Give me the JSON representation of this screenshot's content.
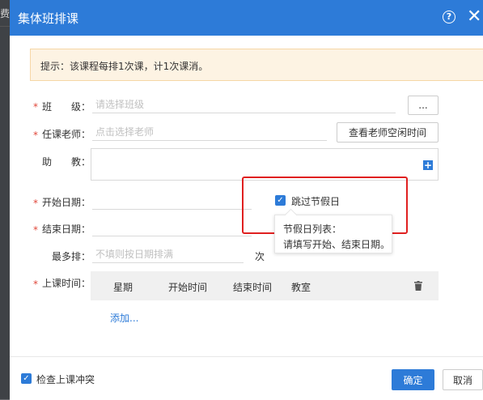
{
  "background": {
    "text": "费"
  },
  "dialog": {
    "title": "集体班排课",
    "tip": "提示：该课程每排1次课，计1次课消。"
  },
  "form": {
    "class": {
      "label": "班　　级：",
      "placeholder": "请选择班级",
      "button_label": "..."
    },
    "teacher": {
      "label": "任课老师：",
      "placeholder": "点击选择老师",
      "button_label": "查看老师空闲时间"
    },
    "assistant": {
      "label": "助　　教："
    },
    "start_date": {
      "label": "开始日期："
    },
    "end_date": {
      "label": "结束日期："
    },
    "max_sessions": {
      "label": "最多排：",
      "placeholder": "不填则按日期排满",
      "suffix": "次"
    },
    "skip_holidays": {
      "label": "跳过节假日",
      "checked": true
    },
    "class_time": {
      "label": "上课时间："
    }
  },
  "tooltip": {
    "title": "节假日列表：",
    "body": "请填写开始、结束日期。"
  },
  "schedule_table": {
    "columns": [
      "星期",
      "开始时间",
      "结束时间",
      "教室"
    ],
    "add_link": "添加..."
  },
  "footer": {
    "check_conflict_label": "检查上课冲突",
    "check_conflict_checked": true,
    "ok_label": "确定",
    "cancel_label": "取消"
  },
  "colors": {
    "primary": "#2d7bd8",
    "required": "#e0483b",
    "highlight": "#e02020",
    "tip_bg": "#fdf3e3"
  }
}
